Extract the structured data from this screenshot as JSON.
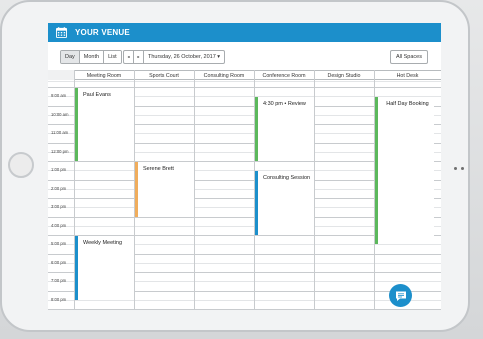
{
  "header": {
    "title": "YOUR VENUE"
  },
  "toolbar": {
    "views": [
      "Day",
      "Month",
      "List"
    ],
    "active_view": "Day",
    "prev_label": "◂",
    "next_label": "▸",
    "date_label": "Thursday, 26 October, 2017 ▾",
    "spaces_label": "All Spaces"
  },
  "columns": [
    "Meeting Room",
    "Sports Court",
    "Consulting Room",
    "Conference Room",
    "Design Studio",
    "Hot Desk"
  ],
  "times": [
    "9:00 am",
    "10:00 am",
    "11:00 am",
    "12:00 pm",
    "1:00 pm",
    "2:00 pm",
    "3:00 pm",
    "4:00 pm",
    "5:00 pm",
    "6:00 pm",
    "7:00 pm",
    "8:00 pm"
  ],
  "events": [
    {
      "label": "Paul Evans",
      "column": 0,
      "start": 0,
      "end": 4,
      "color": "#5cb85c"
    },
    {
      "label": "Serene Brett",
      "column": 1,
      "start": 4,
      "end": 7,
      "color": "#f0ad5c"
    },
    {
      "label": "4:30 pm • Review",
      "column": 3,
      "start": 0.5,
      "end": 4,
      "color": "#5cb85c"
    },
    {
      "label": "Consulting Session",
      "column": 3,
      "start": 4.5,
      "end": 8,
      "color": "#1c8fcb"
    },
    {
      "label": "Half Day Booking",
      "column": 5,
      "start": 0.5,
      "end": 8.5,
      "color": "#5cb85c"
    },
    {
      "label": "Weekly Meeting",
      "column": 0,
      "start": 8,
      "end": 11.5,
      "color": "#1c8fcb"
    }
  ],
  "colors": {
    "accent": "#1c8fcb",
    "green": "#5cb85c",
    "orange": "#f0ad5c"
  }
}
